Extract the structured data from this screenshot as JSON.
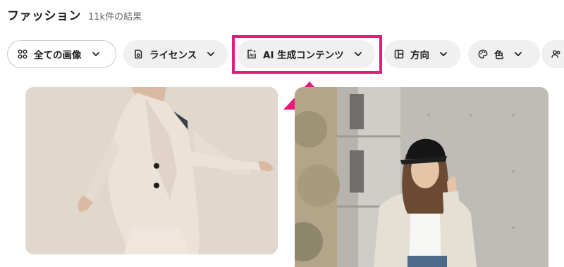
{
  "header": {
    "title": "ファッション",
    "result_count": "11k件の結果"
  },
  "filters": [
    {
      "label": "全ての画像",
      "icon": "grid-icon"
    },
    {
      "label": "ライセンス",
      "icon": "license-icon"
    },
    {
      "label": "AI 生成コンテンツ",
      "icon": "ai-image-icon"
    },
    {
      "label": "方向",
      "icon": "orientation-icon"
    },
    {
      "label": "色",
      "icon": "palette-icon"
    },
    {
      "label": "",
      "icon": "people-icon"
    }
  ],
  "annotation": {
    "highlight_color": "#e6197c"
  }
}
